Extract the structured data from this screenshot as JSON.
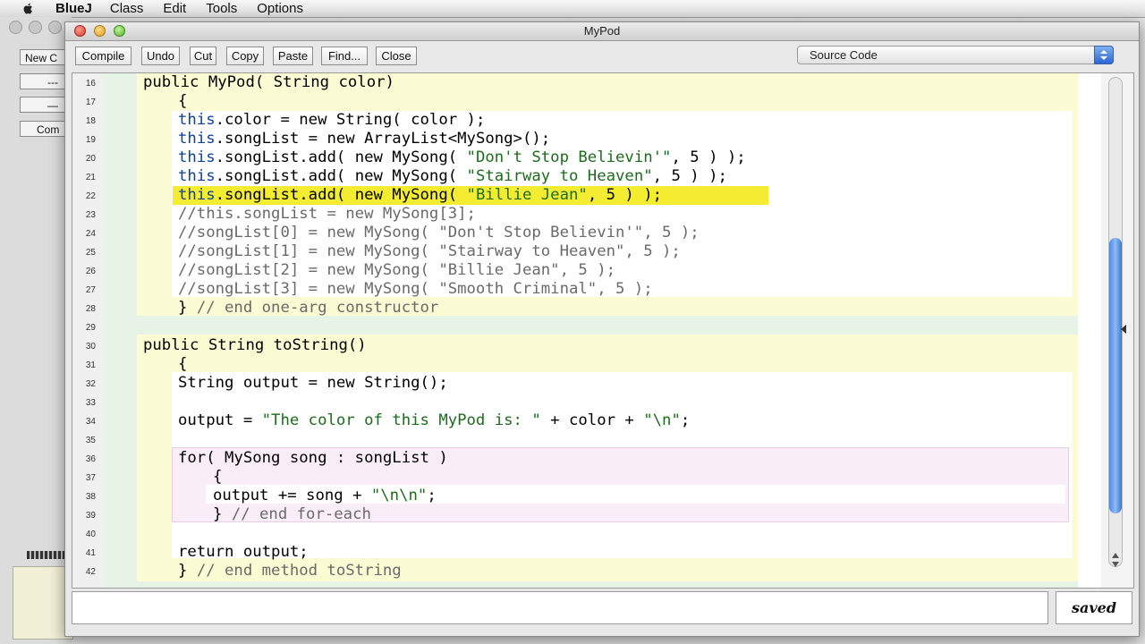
{
  "menubar": {
    "app_name": "BlueJ",
    "items": [
      "Class",
      "Edit",
      "Tools",
      "Options"
    ]
  },
  "background_window": {
    "buttons": [
      "New C",
      "---",
      "—",
      "Com"
    ]
  },
  "editor": {
    "title": "MyPod",
    "toolbar": [
      "Compile",
      "Undo",
      "Cut",
      "Copy",
      "Paste",
      "Find...",
      "Close"
    ],
    "view_selector": "Source Code",
    "status_message": "",
    "save_status": "saved"
  },
  "code": {
    "lines": [
      {
        "n": "16",
        "indent": 0,
        "parts": [
          [
            "kw",
            "public MyPod( String color)"
          ]
        ]
      },
      {
        "n": "17",
        "indent": 1,
        "parts": [
          [
            "kw",
            "{"
          ]
        ]
      },
      {
        "n": "18",
        "indent": 1,
        "parts": [
          [
            "th",
            "this"
          ],
          [
            "kw",
            ".color = new String( color );"
          ]
        ]
      },
      {
        "n": "19",
        "indent": 1,
        "parts": [
          [
            "th",
            "this"
          ],
          [
            "kw",
            ".songList = new ArrayList<MySong>();"
          ]
        ]
      },
      {
        "n": "20",
        "indent": 1,
        "parts": [
          [
            "th",
            "this"
          ],
          [
            "kw",
            ".songList.add( new MySong( "
          ],
          [
            "st",
            "\"Don't Stop Believin'\""
          ],
          [
            "kw",
            ", 5 ) );"
          ]
        ]
      },
      {
        "n": "21",
        "indent": 1,
        "parts": [
          [
            "th",
            "this"
          ],
          [
            "kw",
            ".songList.add( new MySong( "
          ],
          [
            "st",
            "\"Stairway to Heaven\""
          ],
          [
            "kw",
            ", 5 ) );"
          ]
        ]
      },
      {
        "n": "22",
        "indent": 1,
        "parts": [
          [
            "th",
            "this"
          ],
          [
            "kw",
            ".songList.add( new MySong( "
          ],
          [
            "st",
            "\"Billie Jean\""
          ],
          [
            "kw",
            ", 5 ) );"
          ]
        ]
      },
      {
        "n": "23",
        "indent": 1,
        "parts": [
          [
            "cm",
            "//this.songList = new MySong[3];"
          ]
        ]
      },
      {
        "n": "24",
        "indent": 1,
        "parts": [
          [
            "cm",
            "//songList[0] = new MySong( \"Don't Stop Believin'\", 5 );"
          ]
        ]
      },
      {
        "n": "25",
        "indent": 1,
        "parts": [
          [
            "cm",
            "//songList[1] = new MySong( \"Stairway to Heaven\", 5 );"
          ]
        ]
      },
      {
        "n": "26",
        "indent": 1,
        "parts": [
          [
            "cm",
            "//songList[2] = new MySong( \"Billie Jean\", 5 );"
          ]
        ]
      },
      {
        "n": "27",
        "indent": 1,
        "parts": [
          [
            "cm",
            "//songList[3] = new MySong( \"Smooth Criminal\", 5 );"
          ]
        ]
      },
      {
        "n": "28",
        "indent": 1,
        "parts": [
          [
            "kw",
            "} "
          ],
          [
            "cm",
            "// end one-arg constructor"
          ]
        ]
      },
      {
        "n": "29",
        "indent": 0,
        "parts": []
      },
      {
        "n": "30",
        "indent": 0,
        "parts": [
          [
            "kw",
            "public String toString()"
          ]
        ]
      },
      {
        "n": "31",
        "indent": 1,
        "parts": [
          [
            "kw",
            "{"
          ]
        ]
      },
      {
        "n": "32",
        "indent": 1,
        "parts": [
          [
            "kw",
            "String output = new String();"
          ]
        ]
      },
      {
        "n": "33",
        "indent": 1,
        "parts": []
      },
      {
        "n": "34",
        "indent": 1,
        "parts": [
          [
            "kw",
            "output = "
          ],
          [
            "st",
            "\"The color of this MyPod is: \""
          ],
          [
            "kw",
            " + color + "
          ],
          [
            "st",
            "\"\\n\""
          ],
          [
            "kw",
            ";"
          ]
        ]
      },
      {
        "n": "35",
        "indent": 1,
        "parts": []
      },
      {
        "n": "36",
        "indent": 1,
        "parts": [
          [
            "kw",
            "for( MySong song : songList )"
          ]
        ]
      },
      {
        "n": "37",
        "indent": 2,
        "parts": [
          [
            "kw",
            "{"
          ]
        ]
      },
      {
        "n": "38",
        "indent": 2,
        "parts": [
          [
            "kw",
            "output += song + "
          ],
          [
            "st",
            "\"\\n\\n\""
          ],
          [
            "kw",
            ";"
          ]
        ]
      },
      {
        "n": "39",
        "indent": 2,
        "parts": [
          [
            "kw",
            "} "
          ],
          [
            "cm",
            "// end for-each"
          ]
        ]
      },
      {
        "n": "40",
        "indent": 1,
        "parts": []
      },
      {
        "n": "41",
        "indent": 1,
        "parts": [
          [
            "kw",
            "return output;"
          ]
        ]
      },
      {
        "n": "42",
        "indent": 1,
        "parts": [
          [
            "kw",
            "} "
          ],
          [
            "cm",
            "// end method toString"
          ]
        ]
      }
    ],
    "highlighted_line": "22"
  },
  "colors": {
    "method_scope": "#fbfbd4",
    "class_scope": "#e6f3e6",
    "loop_scope": "#f9eef8",
    "highlight": "#f3ec30",
    "this_keyword": "#11409a",
    "string_literal": "#1e6b1e",
    "comment": "#6a6a6a"
  }
}
